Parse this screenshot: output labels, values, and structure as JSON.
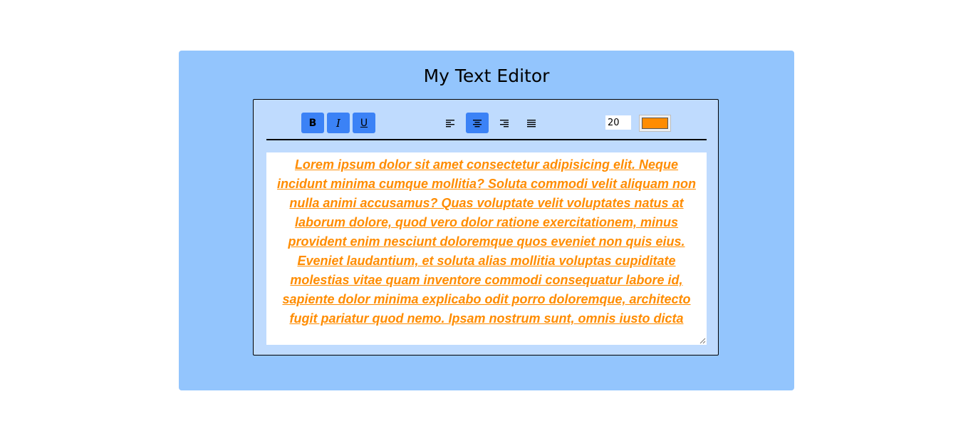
{
  "header": {
    "title": "My Text Editor"
  },
  "toolbar": {
    "format_buttons": [
      {
        "label": "B",
        "name": "bold",
        "active": true
      },
      {
        "label": "I",
        "name": "italic",
        "active": true
      },
      {
        "label": "U",
        "name": "underline",
        "active": true
      }
    ],
    "align_buttons": [
      {
        "name": "align-left",
        "icon": "align-left-icon",
        "active": false
      },
      {
        "name": "align-center",
        "icon": "align-center-icon",
        "active": true
      },
      {
        "name": "align-right",
        "icon": "align-right-icon",
        "active": false
      },
      {
        "name": "justify",
        "icon": "align-justify-icon",
        "active": false
      }
    ],
    "font_size": "20",
    "text_color": "#ff8c00"
  },
  "editor": {
    "text": "Lorem ipsum dolor sit amet consectetur adipisicing elit. Neque incidunt minima cumque mollitia? Soluta commodi velit aliquam non nulla animi accusamus? Quas voluptate velit voluptates natus at laborum dolore, quod vero dolor ratione exercitationem, minus provident enim nesciunt doloremque quos eveniet non quis eius. Eveniet laudantium, et soluta alias mollitia voluptas cupiditate molestias vitae quam inventore commodi consequatur labore id, sapiente dolor minima explicabo odit porro doloremque, architecto fugit pariatur quod nemo. Ipsam nostrum sunt, omnis iusto dicta",
    "alignment": "center"
  },
  "colors": {
    "page_background": "#ffffff",
    "card_background": "#93c5fd",
    "editor_background": "#bfdbfe",
    "active_button": "#3b82f6",
    "text": "#ff8c00"
  }
}
